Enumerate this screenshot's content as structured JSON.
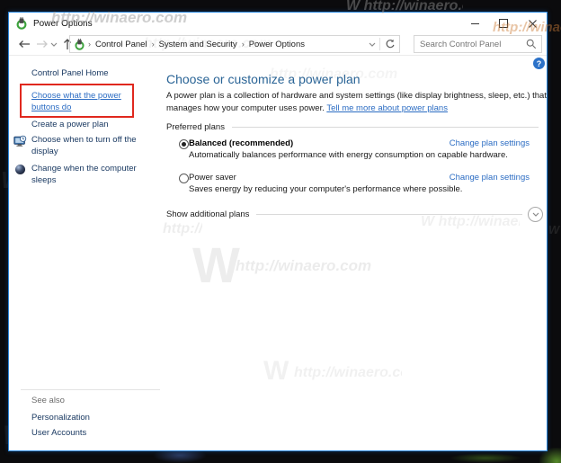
{
  "window": {
    "title": "Power Options",
    "help_glyph": "?"
  },
  "toolbar": {
    "breadcrumb": [
      "Control Panel",
      "System and Security",
      "Power Options"
    ],
    "breadcrumb_sep": "›",
    "search_placeholder": "Search Control Panel"
  },
  "sidebar": {
    "home_label": "Control Panel Home",
    "tasks": [
      {
        "label": "Choose what the power buttons do"
      },
      {
        "label": "Create a power plan"
      },
      {
        "label": "Choose when to turn off the display"
      },
      {
        "label": "Change when the computer sleeps"
      }
    ],
    "see_also_label": "See also",
    "see_also_links": [
      "Personalization",
      "User Accounts"
    ]
  },
  "main": {
    "heading": "Choose or customize a power plan",
    "intro_text": "A power plan is a collection of hardware and system settings (like display brightness, sleep, etc.) that manages how your computer uses power.",
    "intro_link": "Tell me more about power plans",
    "preferred_plans_label": "Preferred plans",
    "plans": [
      {
        "name": "Balanced (recommended)",
        "selected": true,
        "description": "Automatically balances performance with energy consumption on capable hardware.",
        "action": "Change plan settings"
      },
      {
        "name": "Power saver",
        "selected": false,
        "description": "Saves energy by reducing your computer's performance where possible.",
        "action": "Change plan settings"
      }
    ],
    "show_additional_label": "Show additional plans"
  },
  "watermark": {
    "text": "http://winaero.com",
    "big_w": "W"
  },
  "colors": {
    "accent_border": "#2e8ae0",
    "link_blue": "#2b6cc3",
    "sidebar_link": "#16365f",
    "heading_blue": "#2a6496",
    "highlight_red": "#e0281e"
  }
}
